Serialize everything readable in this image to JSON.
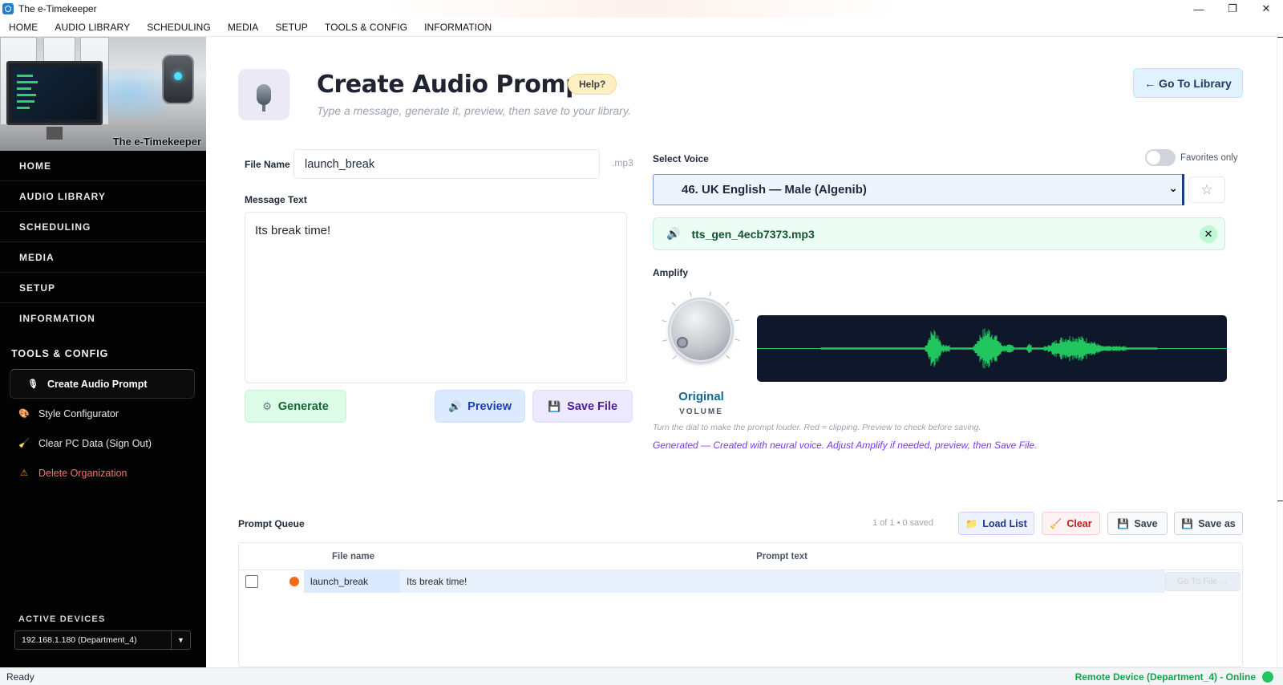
{
  "window": {
    "title": "The e-Timekeeper",
    "minimize": "—",
    "maximize": "❐",
    "close": "✕"
  },
  "menubar": [
    "HOME",
    "AUDIO LIBRARY",
    "SCHEDULING",
    "MEDIA",
    "SETUP",
    "TOOLS & CONFIG",
    "INFORMATION"
  ],
  "sidebar": {
    "hero_caption": "The e-Timekeeper",
    "nav": [
      "HOME",
      "AUDIO LIBRARY",
      "SCHEDULING",
      "MEDIA",
      "SETUP",
      "INFORMATION"
    ],
    "section_title": "TOOLS & CONFIG",
    "tools": [
      {
        "label": "Create Audio Prompt",
        "icon": "microphone-icon",
        "active": true
      },
      {
        "label": "Style Configurator",
        "icon": "palette-icon"
      },
      {
        "label": "Clear PC Data (Sign Out)",
        "icon": "broom-icon"
      },
      {
        "label": "Delete Organization",
        "icon": "warning-icon",
        "danger": true
      }
    ],
    "devices_label": "ACTIVE DEVICES",
    "device_selected": "192.168.1.180  (Department_4)"
  },
  "header": {
    "title": "Create Audio Prompt",
    "help": "Help?",
    "subtitle": "Type a message, generate it, preview, then save to your library.",
    "go_library": "← Go To Library"
  },
  "form": {
    "file_name_label": "File Name",
    "file_name_value": "launch_break",
    "file_ext": ".mp3",
    "message_label": "Message Text",
    "message_value": "Its break time!",
    "generate": "Generate",
    "preview": "Preview",
    "save_file": "Save File"
  },
  "voice": {
    "label": "Select Voice",
    "favorites_label": "Favorites only",
    "favorites_on": false,
    "selected": "46.  UK English — Male (Algenib)",
    "star": "☆",
    "generated_file": "tts_gen_4ecb7373.mp3"
  },
  "amplify": {
    "label": "Amplify",
    "volume_value": "Original",
    "volume_label": "VOLUME",
    "hint": "Turn the dial to make the prompt louder. Red = clipping. Preview to check before saving.",
    "status": "Generated — Created with neural voice.  Adjust Amplify if needed, preview, then Save File."
  },
  "queue": {
    "title": "Prompt Queue",
    "count": "1 of 1   •   0 saved",
    "buttons": {
      "load": "Load List",
      "clear": "Clear",
      "save": "Save",
      "save_as": "Save as"
    },
    "columns": [
      "File name",
      "Prompt text"
    ],
    "rows": [
      {
        "file": "launch_break",
        "text": "Its break time!",
        "go": "Go To File →"
      }
    ]
  },
  "statusbar": {
    "left": "Ready",
    "right": "Remote Device (Department_4) - Online"
  },
  "colors": {
    "accent_green": "#22c55e",
    "wave": "#22c55e",
    "sidebar_bg": "#030303"
  }
}
